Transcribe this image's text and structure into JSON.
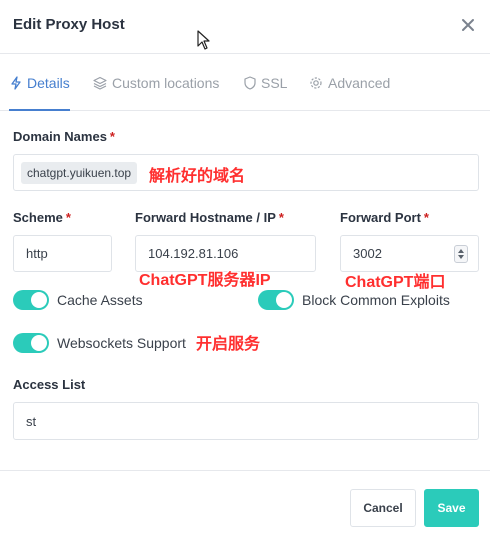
{
  "modal": {
    "title": "Edit Proxy Host"
  },
  "tabs": [
    {
      "label": "Details",
      "icon": "bolt-icon",
      "active": true
    },
    {
      "label": "Custom locations",
      "icon": "layers-icon"
    },
    {
      "label": "SSL",
      "icon": "shield-icon"
    },
    {
      "label": "Advanced",
      "icon": "gear-icon"
    }
  ],
  "form": {
    "domain_names": {
      "label": "Domain Names",
      "required": "*",
      "tags": [
        "chatgpt.yuikuen.top"
      ]
    },
    "scheme": {
      "label": "Scheme",
      "required": "*",
      "value": "http"
    },
    "forward_hostname": {
      "label": "Forward Hostname / IP",
      "required": "*",
      "value": "104.192.81.106"
    },
    "forward_port": {
      "label": "Forward Port",
      "required": "*",
      "value": "3002"
    },
    "toggles": [
      {
        "label": "Cache Assets",
        "on": true
      },
      {
        "label": "Block Common Exploits",
        "on": true
      },
      {
        "label": "Websockets Support",
        "on": true
      }
    ],
    "access_list": {
      "label": "Access List",
      "value": "st"
    }
  },
  "annotations": {
    "domain": "解析好的域名",
    "hostname": "ChatGPT服务器IP",
    "port": "ChatGPT端口",
    "websockets": "开启服务"
  },
  "buttons": {
    "cancel": "Cancel",
    "save": "Save"
  },
  "colors": {
    "accent": "#467fcf",
    "teal": "#2bcbba",
    "required": "#cd201f",
    "annotation": "#ff2f2f"
  }
}
